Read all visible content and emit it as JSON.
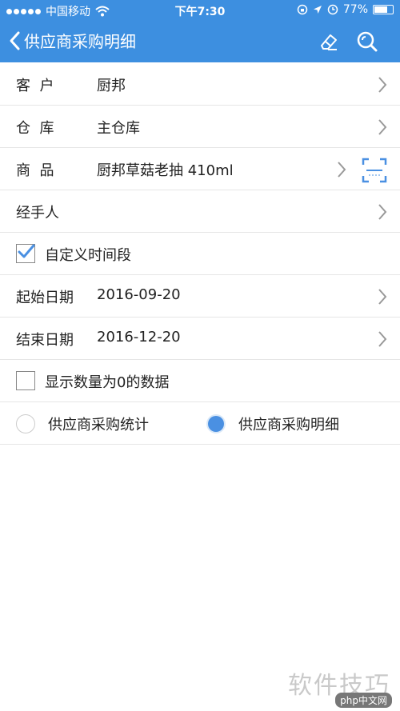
{
  "status_bar": {
    "carrier": "中国移动",
    "time": "下午7:30",
    "battery_percent": "77%",
    "battery_level": 0.77
  },
  "nav": {
    "title": "供应商采购明细"
  },
  "form": {
    "customer": {
      "label": "客  户",
      "value": "厨邦"
    },
    "warehouse": {
      "label": "仓  库",
      "value": "主仓库"
    },
    "product": {
      "label": "商  品",
      "value": "厨邦草菇老抽 410ml"
    },
    "handler": {
      "label": "经手人",
      "value": ""
    },
    "custom_period": {
      "label": "自定义时间段",
      "checked": true
    },
    "start_date": {
      "label": "起始日期",
      "value": "2016-09-20"
    },
    "end_date": {
      "label": "结束日期",
      "value": "2016-12-20"
    },
    "show_zero": {
      "label": "显示数量为0的数据",
      "checked": false
    },
    "report_type": {
      "options": [
        "供应商采购统计",
        "供应商采购明细"
      ],
      "selected": 1
    }
  },
  "watermark": {
    "text": "软件技巧",
    "badge": "php中文网"
  },
  "colors": {
    "primary": "#3d8fe0",
    "radio_selected": "#4a90e2",
    "checkbox_tick": "#4a90e2"
  }
}
